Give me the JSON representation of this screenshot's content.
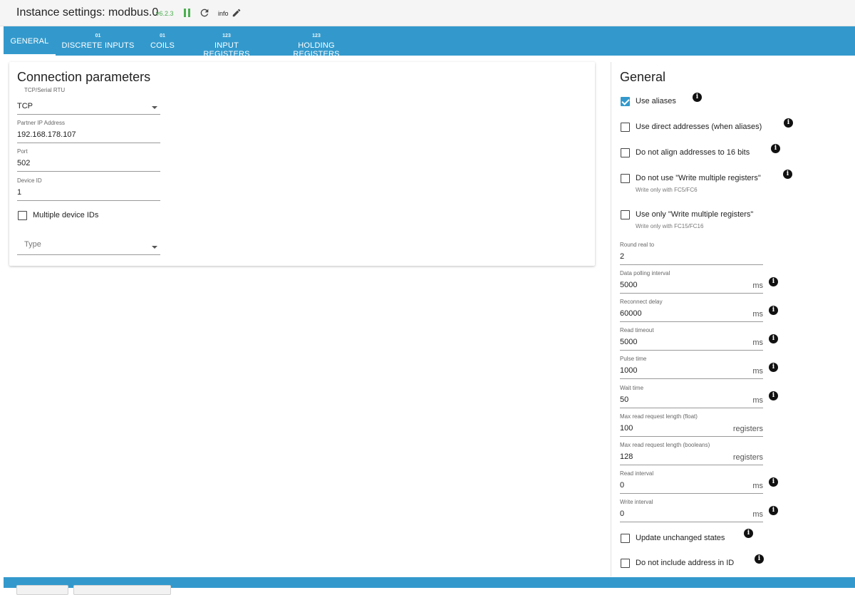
{
  "window": {
    "title": "Instance settings: modbus.0",
    "version": "v6.2.3",
    "info_label": "info"
  },
  "tabs": [
    {
      "label": "GENERAL",
      "icon": ""
    },
    {
      "label": "DISCRETE INPUTS",
      "icon": "01"
    },
    {
      "label": "COILS",
      "icon": "01"
    },
    {
      "label": "INPUT REGISTERS",
      "icon": "123"
    },
    {
      "label": "HOLDING REGISTERS",
      "icon": "123"
    }
  ],
  "connection": {
    "title": "Connection parameters",
    "mode_label": "TCP/Serial RTU",
    "mode_value": "TCP",
    "ip_label": "Partner IP Address",
    "ip_value": "192.168.178.107",
    "port_label": "Port",
    "port_value": "502",
    "device_label": "Device ID",
    "device_value": "1",
    "multi_label": "Multiple device IDs",
    "multi_checked": false,
    "type_placeholder": "Type"
  },
  "general": {
    "title": "General",
    "checks": {
      "use_aliases": {
        "label": "Use aliases",
        "checked": true
      },
      "direct": {
        "label": "Use direct addresses (when aliases)",
        "checked": false
      },
      "align": {
        "label": "Do not align addresses to 16 bits",
        "checked": false
      },
      "no_multi": {
        "label": "Do not use \"Write multiple registers\"",
        "hint": "Write only with FC5/FC6",
        "checked": false
      },
      "only_multi": {
        "label": "Use only \"Write multiple registers\"",
        "hint": "Write only with FC15/FC16",
        "checked": false
      },
      "unchanged": {
        "label": "Update unchanged states",
        "checked": false
      },
      "no_addr": {
        "label": "Do not include address in ID",
        "checked": false
      }
    },
    "fields": {
      "round": {
        "label": "Round real to",
        "value": "2",
        "unit": ""
      },
      "poll": {
        "label": "Data polling interval",
        "value": "5000",
        "unit": "ms"
      },
      "reconnect": {
        "label": "Reconnect delay",
        "value": "60000",
        "unit": "ms"
      },
      "timeout": {
        "label": "Read timeout",
        "value": "5000",
        "unit": "ms"
      },
      "pulse": {
        "label": "Pulse time",
        "value": "1000",
        "unit": "ms"
      },
      "wait": {
        "label": "Wait time",
        "value": "50",
        "unit": "ms"
      },
      "max_float": {
        "label": "Max read request length (float)",
        "value": "100",
        "unit": "registers"
      },
      "max_bool": {
        "label": "Max read request length (booleans)",
        "value": "128",
        "unit": "registers"
      },
      "read_int": {
        "label": "Read interval",
        "value": "0",
        "unit": "ms"
      },
      "write_int": {
        "label": "Write interval",
        "value": "0",
        "unit": "ms"
      }
    }
  },
  "colors": {
    "accent": "#3399cc",
    "status_green": "#4caf50"
  },
  "icons": {
    "pause": "pause-icon",
    "refresh": "refresh-icon",
    "edit": "pencil-icon",
    "info": "info-icon",
    "dropdown": "chevron-down-icon"
  }
}
